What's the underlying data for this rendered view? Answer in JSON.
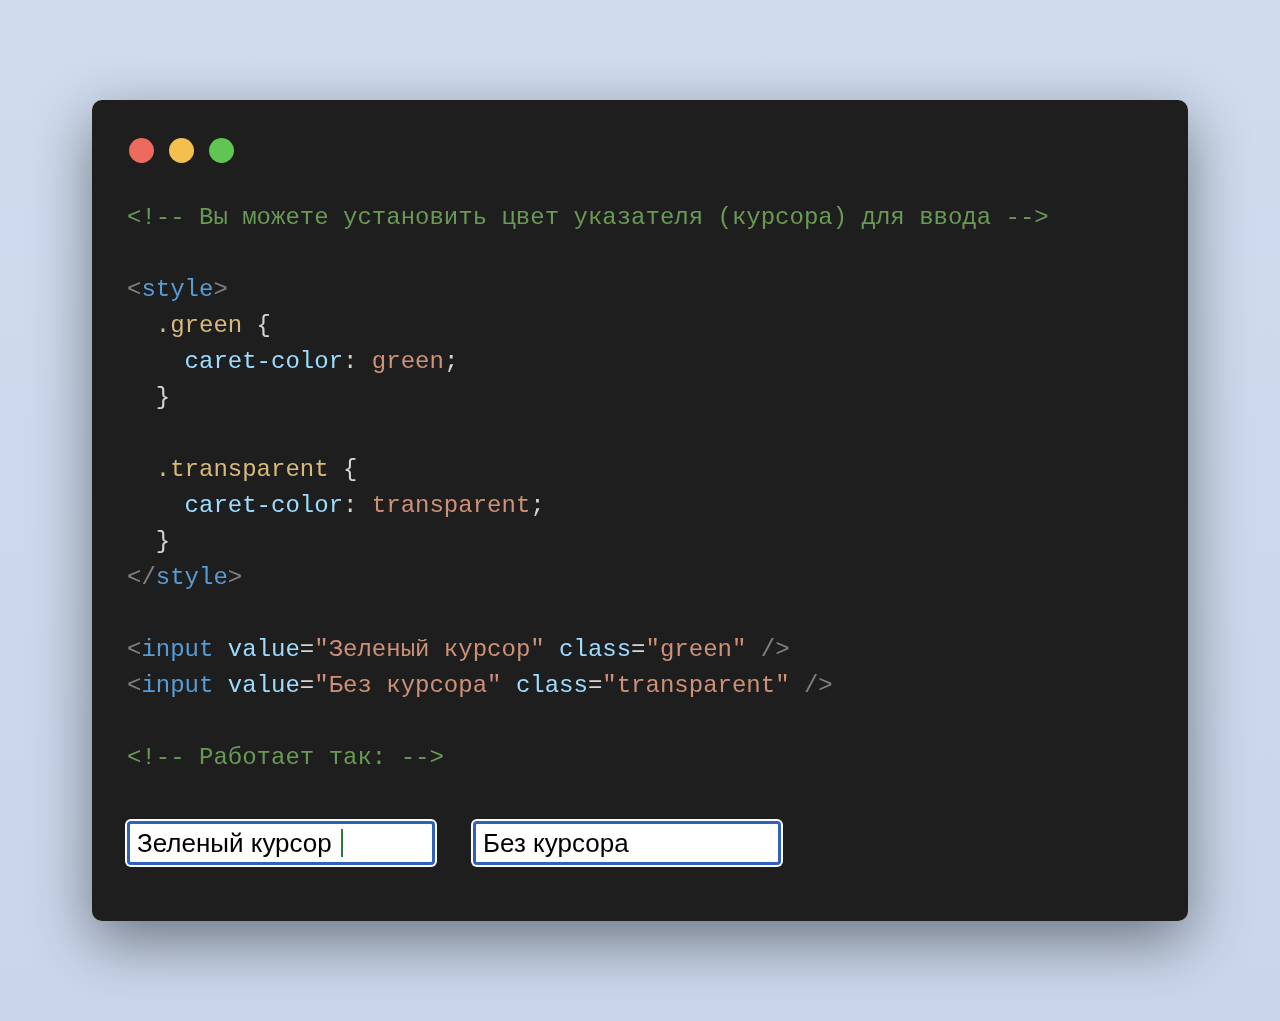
{
  "window": {
    "controls": [
      {
        "kind": "close"
      },
      {
        "kind": "minimize"
      },
      {
        "kind": "zoom"
      }
    ]
  },
  "code_blocks": [
    [
      [
        {
          "kind": "comment",
          "text": "<!-- Вы можете установить цвет указателя (курсора) для ввода -->"
        }
      ]
    ],
    [
      [
        {
          "kind": "punct",
          "text": "<"
        },
        {
          "kind": "tag",
          "text": "style"
        },
        {
          "kind": "punct",
          "text": ">"
        }
      ],
      [
        {
          "kind": "selector",
          "text": "  .green"
        },
        {
          "kind": "plain",
          "text": " {"
        }
      ],
      [
        {
          "kind": "property",
          "text": "    caret-color"
        },
        {
          "kind": "plain",
          "text": ": "
        },
        {
          "kind": "string",
          "text": "green"
        },
        {
          "kind": "plain",
          "text": ";"
        }
      ],
      [
        {
          "kind": "plain",
          "text": "  }"
        }
      ]
    ],
    [
      [
        {
          "kind": "selector",
          "text": "  .transparent"
        },
        {
          "kind": "plain",
          "text": " {"
        }
      ],
      [
        {
          "kind": "property",
          "text": "    caret-color"
        },
        {
          "kind": "plain",
          "text": ": "
        },
        {
          "kind": "string",
          "text": "transparent"
        },
        {
          "kind": "plain",
          "text": ";"
        }
      ],
      [
        {
          "kind": "plain",
          "text": "  }"
        }
      ],
      [
        {
          "kind": "punct",
          "text": "</"
        },
        {
          "kind": "tag",
          "text": "style"
        },
        {
          "kind": "punct",
          "text": ">"
        }
      ]
    ],
    [
      [
        {
          "kind": "punct",
          "text": "<"
        },
        {
          "kind": "tag",
          "text": "input"
        },
        {
          "kind": "property",
          "text": " value"
        },
        {
          "kind": "plain",
          "text": "="
        },
        {
          "kind": "string",
          "text": "\"Зеленый курсор\""
        },
        {
          "kind": "property",
          "text": " class"
        },
        {
          "kind": "plain",
          "text": "="
        },
        {
          "kind": "string",
          "text": "\"green\""
        },
        {
          "kind": "punct",
          "text": " />"
        }
      ],
      [
        {
          "kind": "punct",
          "text": "<"
        },
        {
          "kind": "tag",
          "text": "input"
        },
        {
          "kind": "property",
          "text": " value"
        },
        {
          "kind": "plain",
          "text": "="
        },
        {
          "kind": "string",
          "text": "\"Без курсора\""
        },
        {
          "kind": "property",
          "text": " class"
        },
        {
          "kind": "plain",
          "text": "="
        },
        {
          "kind": "string",
          "text": "\"transparent\""
        },
        {
          "kind": "punct",
          "text": " />"
        }
      ]
    ],
    [
      [
        {
          "kind": "comment",
          "text": "<!-- Работает так: -->"
        }
      ]
    ]
  ],
  "inputs": [
    {
      "value": "Зеленый курсор",
      "caret": true,
      "color": "#2e7d32"
    },
    {
      "value": "Без курсора",
      "caret": false
    }
  ]
}
